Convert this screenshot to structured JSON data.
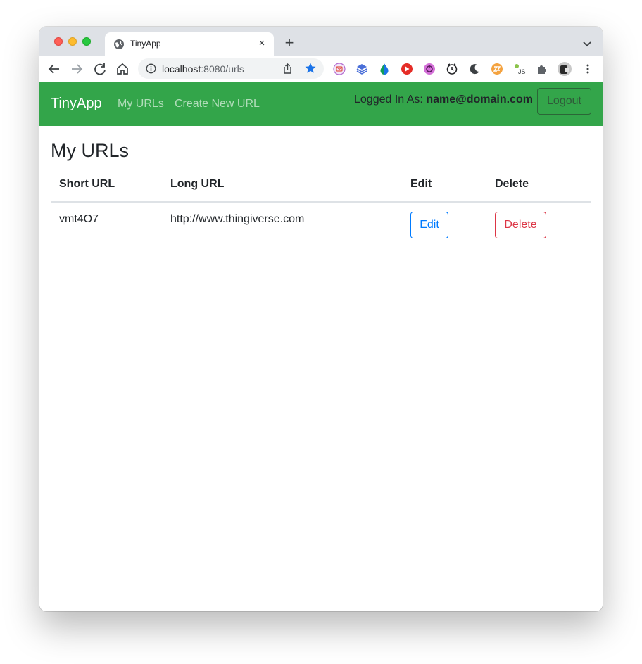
{
  "browser": {
    "tab": {
      "title": "TinyApp",
      "close_glyph": "×",
      "favicon": "globe-icon"
    },
    "new_tab_glyph": "+",
    "address": {
      "host": "localhost",
      "path": ":8080/urls"
    },
    "extensions": [
      "ext-mail-icon",
      "ext-layers-icon",
      "ext-drop-icon",
      "ext-play-icon",
      "ext-record-icon",
      "ext-clock-icon",
      "ext-moon-icon",
      "ext-zz-icon",
      "ext-js-icon",
      "puzzle-icon",
      "avatar",
      "more-vert-icon"
    ]
  },
  "navbar": {
    "brand": "TinyApp",
    "links": [
      "My URLs",
      "Create New URL"
    ],
    "logged_in_label": "Logged In As:",
    "user_email": "name@domain.com",
    "logout_label": "Logout",
    "color": "#33a54a"
  },
  "main": {
    "title": "My URLs",
    "table": {
      "headers": [
        "Short URL",
        "Long URL",
        "Edit",
        "Delete"
      ],
      "rows": [
        {
          "short_url": "vmt4O7",
          "long_url": "http://www.thingiverse.com",
          "edit_label": "Edit",
          "delete_label": "Delete"
        }
      ]
    }
  },
  "colors": {
    "primary": "#007bff",
    "danger": "#dc3545",
    "star": "#1a73e8"
  }
}
